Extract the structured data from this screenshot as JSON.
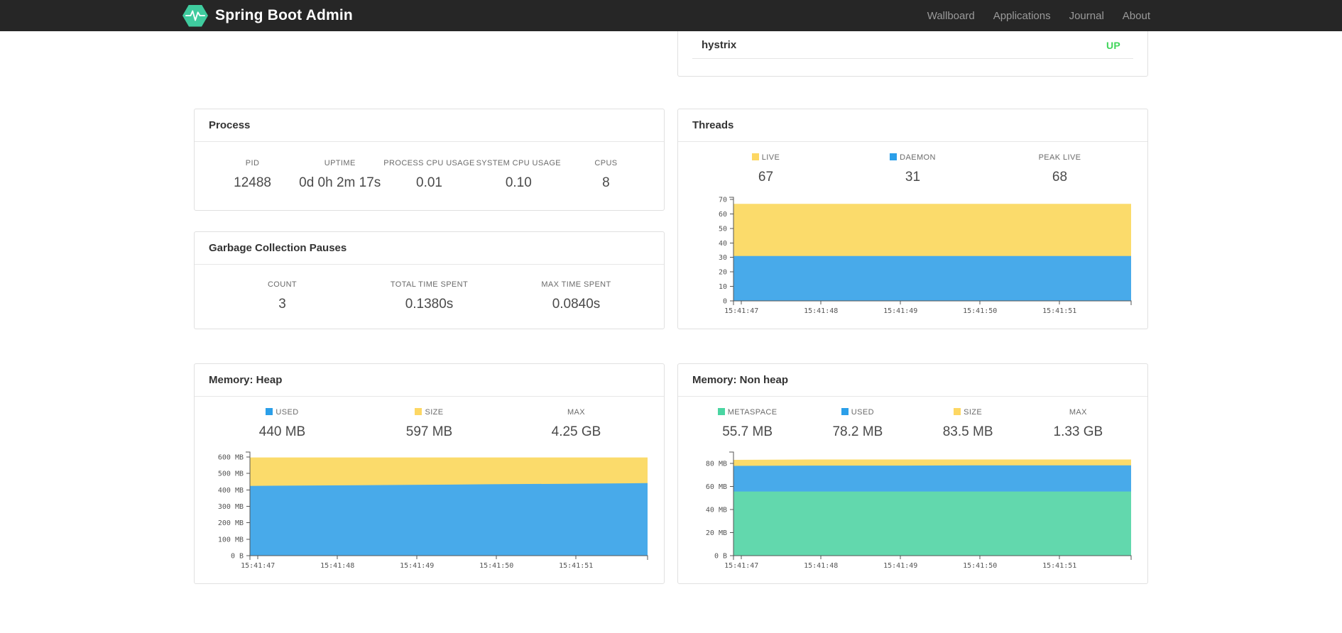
{
  "navbar": {
    "brand": "Spring Boot Admin",
    "items": [
      {
        "label": "Wallboard"
      },
      {
        "label": "Applications"
      },
      {
        "label": "Journal"
      },
      {
        "label": "About"
      }
    ],
    "colors": {
      "bg": "#262626",
      "logo_green": "#3fcb9e"
    }
  },
  "health": {
    "name": "hystrix",
    "status": "UP",
    "status_color": "#41d65b"
  },
  "cards": {
    "process": {
      "title": "Process",
      "stats": [
        {
          "label": "PID",
          "value": "12488"
        },
        {
          "label": "UPTIME",
          "value": "0d 0h 2m 17s"
        },
        {
          "label": "PROCESS CPU USAGE",
          "value": "0.01"
        },
        {
          "label": "SYSTEM CPU USAGE",
          "value": "0.10"
        },
        {
          "label": "CPUS",
          "value": "8"
        }
      ]
    },
    "gc": {
      "title": "Garbage Collection Pauses",
      "stats": [
        {
          "label": "COUNT",
          "value": "3"
        },
        {
          "label": "TOTAL TIME SPENT",
          "value": "0.1380s"
        },
        {
          "label": "MAX TIME SPENT",
          "value": "0.0840s"
        }
      ]
    },
    "threads": {
      "title": "Threads",
      "stats": [
        {
          "label": "LIVE",
          "value": "67",
          "color": "#fdd763"
        },
        {
          "label": "DAEMON",
          "value": "31",
          "color": "#2b9fe9"
        },
        {
          "label": "PEAK LIVE",
          "value": "68"
        }
      ]
    },
    "heap": {
      "title": "Memory: Heap",
      "stats": [
        {
          "label": "USED",
          "value": "440 MB",
          "color": "#2b9fe9"
        },
        {
          "label": "SIZE",
          "value": "597 MB",
          "color": "#fdd763"
        },
        {
          "label": "MAX",
          "value": "4.25 GB"
        }
      ]
    },
    "nonheap": {
      "title": "Memory: Non heap",
      "stats": [
        {
          "label": "METASPACE",
          "value": "55.7 MB",
          "color": "#4ad5a2"
        },
        {
          "label": "USED",
          "value": "78.2 MB",
          "color": "#2b9fe9"
        },
        {
          "label": "SIZE",
          "value": "83.5 MB",
          "color": "#fdd763"
        },
        {
          "label": "MAX",
          "value": "1.33 GB"
        }
      ]
    }
  },
  "chart_data": [
    {
      "id": "threads",
      "type": "area",
      "title": "Threads",
      "legend": [
        "LIVE",
        "DAEMON"
      ],
      "x_domain": [
        46.9,
        51.9
      ],
      "x_ticks": [
        {
          "v": 47,
          "label": "15:41:47"
        },
        {
          "v": 48,
          "label": "15:41:48"
        },
        {
          "v": 49,
          "label": "15:41:49"
        },
        {
          "v": 50,
          "label": "15:41:50"
        },
        {
          "v": 51,
          "label": "15:41:51"
        }
      ],
      "y_domain": [
        0,
        71.5
      ],
      "y_ticks": [
        {
          "v": 0,
          "label": "0"
        },
        {
          "v": 10,
          "label": "10"
        },
        {
          "v": 20,
          "label": "20"
        },
        {
          "v": 30,
          "label": "30"
        },
        {
          "v": 40,
          "label": "40"
        },
        {
          "v": 50,
          "label": "50"
        },
        {
          "v": 60,
          "label": "60"
        },
        {
          "v": 70,
          "label": "70"
        }
      ],
      "series": [
        {
          "name": "live",
          "color": "#fbdb6b",
          "values": [
            67,
            67,
            67,
            67,
            67,
            67
          ]
        },
        {
          "name": "daemon",
          "color": "#48aaea",
          "values": [
            31,
            31,
            31,
            31,
            31,
            31
          ]
        }
      ]
    },
    {
      "id": "heap",
      "type": "area",
      "title": "Memory: Heap",
      "legend": [
        "USED",
        "SIZE"
      ],
      "x_domain": [
        46.9,
        51.9
      ],
      "x_ticks": [
        {
          "v": 47,
          "label": "15:41:47"
        },
        {
          "v": 48,
          "label": "15:41:48"
        },
        {
          "v": 49,
          "label": "15:41:49"
        },
        {
          "v": 50,
          "label": "15:41:50"
        },
        {
          "v": 51,
          "label": "15:41:51"
        }
      ],
      "y_domain": [
        0,
        630
      ],
      "y_ticks": [
        {
          "v": 0,
          "label": "0 B"
        },
        {
          "v": 100,
          "label": "100 MB"
        },
        {
          "v": 200,
          "label": "200 MB"
        },
        {
          "v": 300,
          "label": "300 MB"
        },
        {
          "v": 400,
          "label": "400 MB"
        },
        {
          "v": 500,
          "label": "500 MB"
        },
        {
          "v": 600,
          "label": "600 MB"
        }
      ],
      "series": [
        {
          "name": "size",
          "color": "#fbdb6b",
          "values": [
            597,
            597,
            597,
            597,
            597,
            597
          ]
        },
        {
          "name": "used",
          "color": "#48aaea",
          "values": [
            424,
            427,
            430,
            434,
            437,
            441
          ]
        }
      ]
    },
    {
      "id": "nonheap",
      "type": "area",
      "title": "Memory: Non heap",
      "legend": [
        "METASPACE",
        "USED",
        "SIZE"
      ],
      "x_domain": [
        46.9,
        51.9
      ],
      "x_ticks": [
        {
          "v": 47,
          "label": "15:41:47"
        },
        {
          "v": 48,
          "label": "15:41:48"
        },
        {
          "v": 49,
          "label": "15:41:49"
        },
        {
          "v": 50,
          "label": "15:41:50"
        },
        {
          "v": 51,
          "label": "15:41:51"
        }
      ],
      "y_domain": [
        0,
        90
      ],
      "y_ticks": [
        {
          "v": 0,
          "label": "0 B"
        },
        {
          "v": 20,
          "label": "20 MB"
        },
        {
          "v": 40,
          "label": "40 MB"
        },
        {
          "v": 60,
          "label": "60 MB"
        },
        {
          "v": 80,
          "label": "80 MB"
        }
      ],
      "series": [
        {
          "name": "size",
          "color": "#fbdb6b",
          "values": [
            83.2,
            83.5,
            83.5,
            83.5,
            83.5,
            83.5
          ]
        },
        {
          "name": "used",
          "color": "#48aaea",
          "values": [
            78.0,
            78.2,
            78.2,
            78.4,
            78.4,
            78.4
          ]
        },
        {
          "name": "metaspace",
          "color": "#62d8ad",
          "values": [
            55.7,
            55.7,
            55.7,
            55.7,
            55.7,
            55.7
          ]
        }
      ]
    }
  ]
}
